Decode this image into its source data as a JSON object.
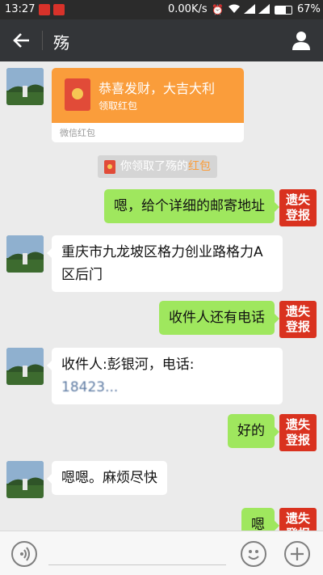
{
  "status_bar": {
    "time": "13:27",
    "network_speed": "0.00K/s",
    "battery": "67%",
    "battery_level": 0.67
  },
  "header": {
    "back_icon": "arrow-left-icon",
    "title": "殇",
    "profile_icon": "person-icon"
  },
  "messages": {
    "red_packet": {
      "text": "恭喜发财，大吉大利",
      "action": "领取红包",
      "footer": "微信红包"
    },
    "system_note": {
      "prefix": "你领取了殇的",
      "highlight": "红包"
    },
    "lost_badge": {
      "line1": "遗失",
      "line2": "登报"
    },
    "m1": "嗯，给个详细的邮寄地址",
    "m2_line1": "重庆市九龙坡区格力创业路格力A",
    "m2_line2": "区后门",
    "m3": "收件人还有电话",
    "m4_line1": "收件人:彭银河，电话:",
    "m4_phone": "18423...",
    "m5": "好的",
    "m6": "嗯嗯。麻烦尽快",
    "m7": "嗯"
  },
  "input_bar": {
    "voice_icon": "voice-icon",
    "emoji_icon": "emoji-icon",
    "plus_icon": "plus-icon"
  },
  "colors": {
    "titlebar": "#333538",
    "chat_bg": "#ebebeb",
    "sent_bubble": "#9fe75e",
    "red_packet": "#fa9d3b",
    "badge": "#d9321f"
  }
}
